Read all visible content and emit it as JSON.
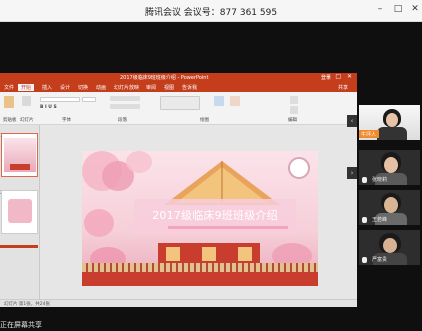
{
  "window": {
    "title": "腾讯会议 会议号：877 361 595",
    "min_icon": "minimize-icon",
    "max_icon": "maximize-icon",
    "close_icon": "close-icon"
  },
  "ppt": {
    "title": "2017级临床9班班级介绍 - PowerPoint",
    "login": "登录",
    "tabs": [
      "文件",
      "开始",
      "插入",
      "设计",
      "切换",
      "动画",
      "幻灯片放映",
      "审阅",
      "视图",
      "告诉我"
    ],
    "active_tab": "开始",
    "share_label": "共享",
    "ribbon_groups": [
      "剪贴板",
      "幻灯片",
      "字体",
      "段落",
      "绘图",
      "编辑"
    ],
    "thumb_numbers": [
      "1",
      "2"
    ],
    "slide_title": "2017级临床9班班级介绍",
    "status": "幻灯片 第1张，共24张"
  },
  "videos": [
    {
      "name": "牛坪人",
      "color": "#3a3a3a"
    },
    {
      "name": "张晓莉",
      "color": "#2d2d2d"
    },
    {
      "name": "王若峰",
      "color": "#2d2d2d"
    },
    {
      "name": "严富贵",
      "color": "#2d2d2d"
    }
  ],
  "share_status": "正在屏幕共享",
  "colors": {
    "ppt_accent": "#c43e1c",
    "slide_pink": "#f6cfd9",
    "slide_title": "#ffffff"
  }
}
